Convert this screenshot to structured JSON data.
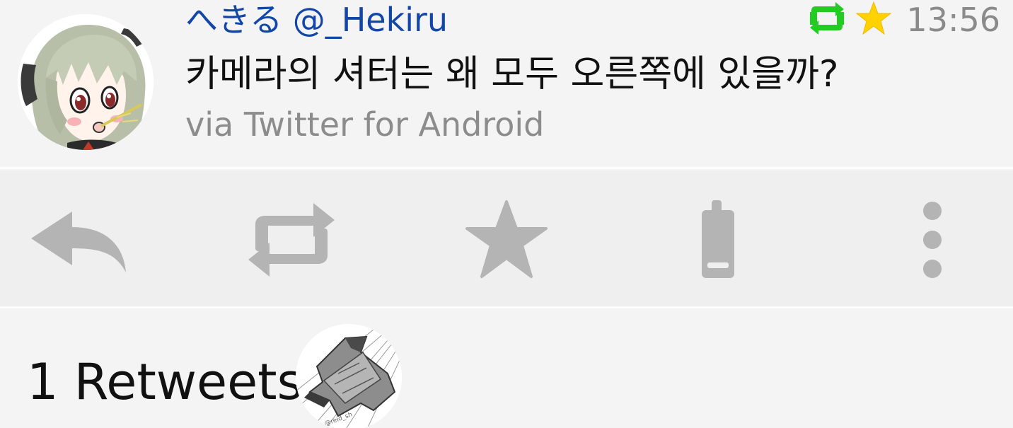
{
  "tweet": {
    "author": "へきる @_Hekiru",
    "time": "13:56",
    "text": "카메라의 셔터는 왜 모두 오른쪽에 있을까?",
    "via": "via Twitter for Android",
    "retweeted_color": "#22cc22",
    "favorited_color": "#ffd200"
  },
  "actions": [
    {
      "icon": "reply-icon"
    },
    {
      "icon": "retweet-icon"
    },
    {
      "icon": "favorite-star-icon"
    },
    {
      "icon": "phone-share-icon"
    },
    {
      "icon": "more-vertical-icon"
    }
  ],
  "retweets": {
    "label": "1 Retweets"
  },
  "colors": {
    "background": "#f4f4f4",
    "action_icon": "#b4b4b4",
    "author_link": "#1346a8"
  }
}
